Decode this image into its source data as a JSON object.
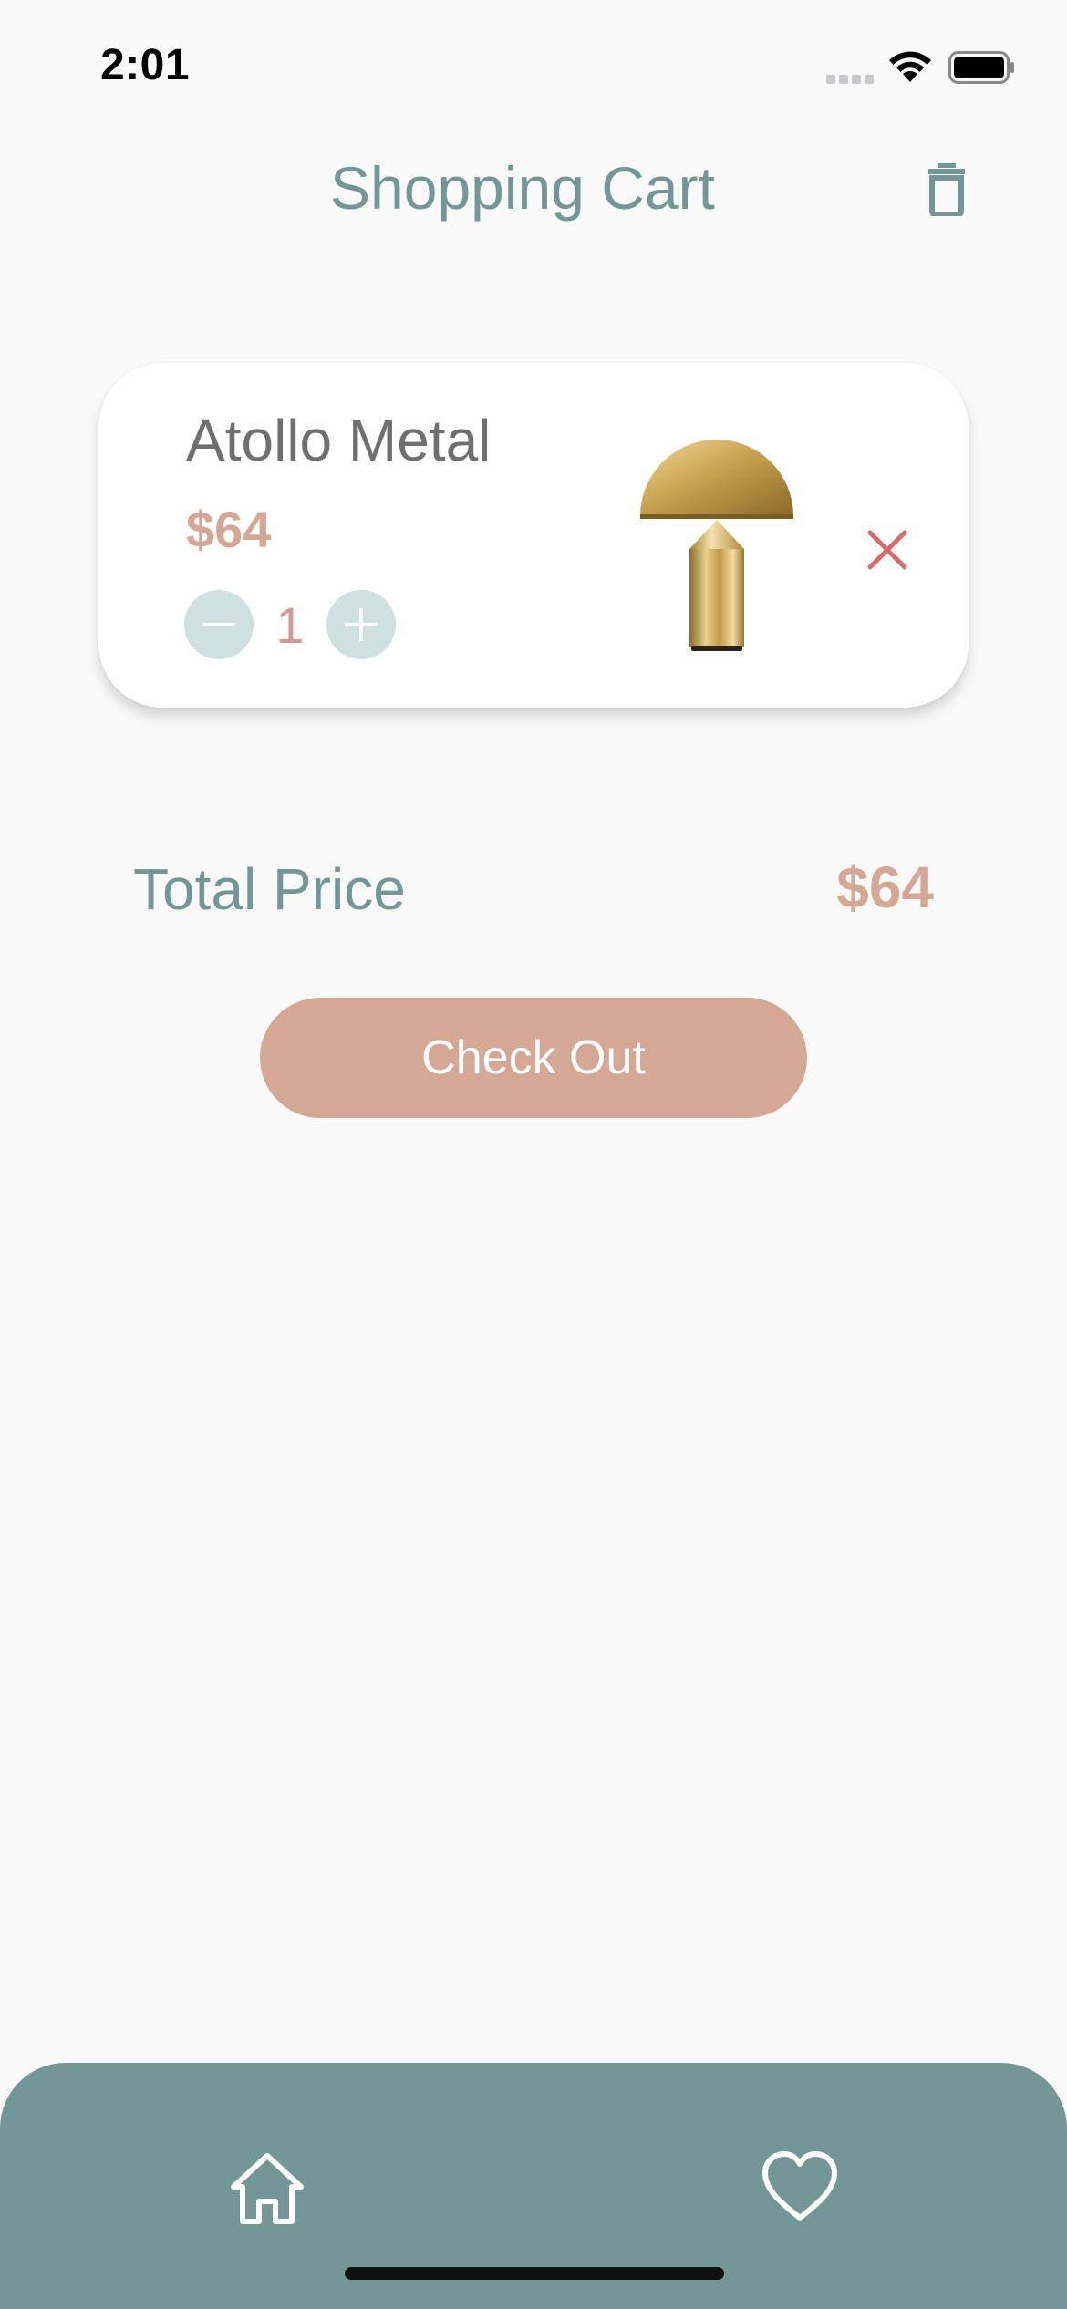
{
  "status_bar": {
    "time": "2:01"
  },
  "header": {
    "title": "Shopping Cart",
    "action_icon": "trash-icon"
  },
  "cart": {
    "items": [
      {
        "name": "Atollo Metal",
        "price": "$64",
        "quantity": "1",
        "image": "gold-mushroom-table-lamp"
      }
    ]
  },
  "summary": {
    "total_label": "Total Price",
    "total_value": "$64"
  },
  "checkout": {
    "label": "Check Out"
  },
  "bottom_nav": {
    "items": [
      {
        "icon": "home-icon"
      },
      {
        "icon": "heart-icon"
      }
    ]
  },
  "colors": {
    "primary": "#739797",
    "accent": "#d5a895",
    "background": "#f9f9f9",
    "remove": "#d66b6b",
    "qty_button": "#cfe0e0"
  }
}
